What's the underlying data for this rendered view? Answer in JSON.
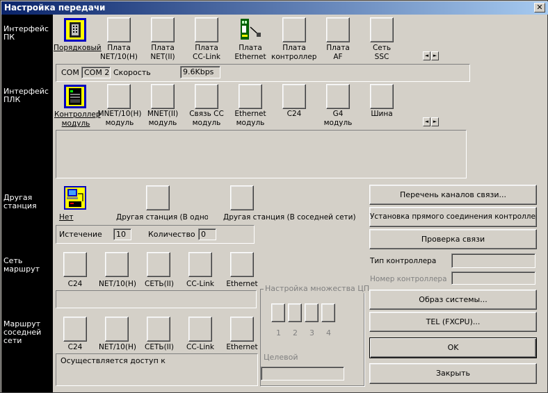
{
  "window": {
    "title": "Настройка передачи",
    "close_glyph": "✕"
  },
  "sidebar": {
    "pc_interface": "Интерфейс\nПК",
    "plc_interface": "Интерфейс\nПЛК",
    "other_station": "Другая\nстанция",
    "net_route": "Сеть\nмаршрут",
    "coexist_route": "Маршрут\nсоседней\nсети"
  },
  "pc_items": [
    {
      "label": "Порядковый",
      "icon": "serial-port-icon",
      "selected": true
    },
    {
      "label": "Плата\nNET/10(H)",
      "icon": "blank-button-icon"
    },
    {
      "label": "Плата\nNET(II)",
      "icon": "blank-button-icon"
    },
    {
      "label": "Плата\nCC-Link",
      "icon": "blank-button-icon"
    },
    {
      "label": "Плата\nEthernet",
      "icon": "ethernet-card-icon"
    },
    {
      "label": "Плата\nконтроллера",
      "icon": "blank-button-icon"
    },
    {
      "label": "Плата\nAF",
      "icon": "blank-button-icon"
    },
    {
      "label": "Сеть\nSSC",
      "icon": "blank-button-icon"
    }
  ],
  "pc_settings": {
    "com_label": "COM",
    "com_value": "COM 2",
    "speed_label": "Скорость",
    "speed_value": "9.6Kbps"
  },
  "plc_items": [
    {
      "label": "Контроллер\nмодуль",
      "icon": "plc-module-icon",
      "selected": true
    },
    {
      "label": "MNET/10(H)\nмодуль",
      "icon": "blank-button-icon"
    },
    {
      "label": "MNET(II)\nмодуль",
      "icon": "blank-button-icon"
    },
    {
      "label": "Связь CC\nмодуль",
      "icon": "blank-button-icon"
    },
    {
      "label": "Ethernet\nмодуль",
      "icon": "blank-button-icon"
    },
    {
      "label": "C24",
      "icon": "blank-button-icon"
    },
    {
      "label": "G4\nмодуль",
      "icon": "blank-button-icon"
    },
    {
      "label": "Шина",
      "icon": "blank-button-icon"
    }
  ],
  "other_station": {
    "items": [
      {
        "label": "Нет",
        "icon": "no-other-station-icon",
        "selected": true
      },
      {
        "label": "Другая станция (В одной",
        "icon": "blank-button-icon"
      },
      {
        "label": "Другая станция (В соседней сети)",
        "icon": "blank-button-icon"
      }
    ],
    "timeout_label": "Истечение",
    "timeout_value": "10",
    "count_label": "Количество",
    "count_value": "0"
  },
  "network_route": {
    "items": [
      "C24",
      "NET/10(H)",
      "СЕТЬ(II)",
      "CC-Link",
      "Ethernet"
    ]
  },
  "coexist_route": {
    "items": [
      "C24",
      "NET/10(H)",
      "СЕТЬ(II)",
      "CC-Link",
      "Ethernet"
    ],
    "access_text": "Осуществляется доступ к"
  },
  "multi_cpu": {
    "legend": "Настройка множества ЦП",
    "cpus": [
      "1",
      "2",
      "3",
      "4"
    ],
    "target_label": "Целевой"
  },
  "right_panel": {
    "channel_list": "Перечень каналов связи...",
    "direct_connect": "Установка прямого соединения контроллера",
    "connection_test": "Проверка связи",
    "plc_type_label": "Тип контроллера",
    "plc_number_label": "Номер контроллера",
    "system_image": "Образ системы...",
    "tel": "TEL (FXCPU)...",
    "ok": "OK",
    "close": "Закрыть"
  },
  "scroll": {
    "left_glyph": "◄",
    "right_glyph": "►"
  }
}
